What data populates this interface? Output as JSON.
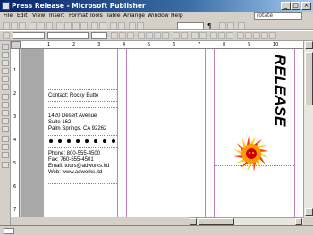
{
  "window": {
    "title": "Press Release - Microsoft Publisher",
    "minimize": "_",
    "maximize": "□",
    "close": "×"
  },
  "menu": {
    "items": [
      "File",
      "Edit",
      "View",
      "Insert",
      "Format",
      "Tools",
      "Table",
      "Arrange",
      "Window",
      "Help"
    ],
    "help_placeholder": "rotate"
  },
  "toolbar": {
    "zoom": "¶"
  },
  "rulers": {
    "h_numbers": [
      "1",
      "2",
      "3",
      "4",
      "5",
      "6",
      "7",
      "8",
      "9",
      "10"
    ],
    "v_numbers": [
      "1",
      "2",
      "3",
      "4",
      "5",
      "6",
      "7"
    ]
  },
  "page": {
    "contact": "Contact: Rocky Butte",
    "address_line1": "1420 Desert Avenue",
    "address_line2": "Suite 162",
    "address_line3": "Palm Springs, CA 92262",
    "phone": "Phone: 800-555-4500",
    "fax": "Fax: 760-555-4501",
    "email": "Email: tours@adworks.ltd",
    "web": "Web: www.adworks.ltd",
    "headline": "RELEASE",
    "logo_colors": {
      "sun": "#ff9900",
      "rays": "#ff3300",
      "center": "#cc0000"
    }
  }
}
